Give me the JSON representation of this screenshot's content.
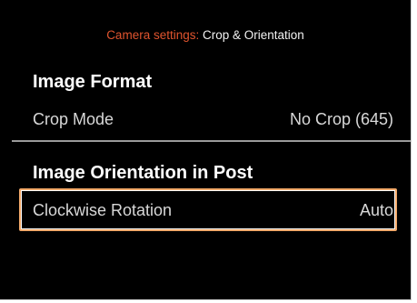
{
  "header": {
    "prefix": "Camera settings:",
    "title": "Crop & Orientation"
  },
  "sections": [
    {
      "heading": "Image Format",
      "rows": [
        {
          "label": "Crop Mode",
          "value": "No Crop (645)"
        }
      ]
    },
    {
      "heading": "Image Orientation in Post",
      "rows": [
        {
          "label": "Clockwise Rotation",
          "value": "Auto",
          "selected": true
        }
      ]
    }
  ],
  "colors": {
    "background": "#000000",
    "header_prefix": "#e0542e",
    "selection_border": "#f2a96a",
    "divider": "#9a9a9a"
  }
}
